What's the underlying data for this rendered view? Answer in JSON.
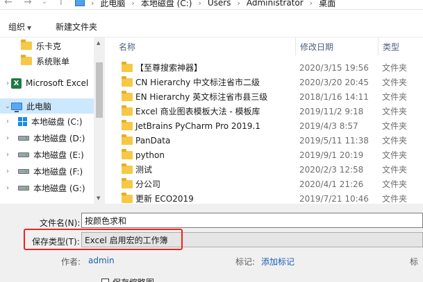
{
  "address": {
    "crumbs": [
      "此电脑",
      "本地磁盘 (C:)",
      "Users",
      "Administrator",
      "桌面"
    ]
  },
  "toolbar": {
    "organize": "组织",
    "new_folder": "新建文件夹"
  },
  "nav": {
    "items": [
      {
        "label": "乐卡克",
        "icon": "folder-icon"
      },
      {
        "label": "系统账单",
        "icon": "folder-icon"
      },
      {
        "label": "Microsoft Excel",
        "icon": "excel-icon"
      },
      {
        "label": "此电脑",
        "icon": "computer-icon"
      },
      {
        "label": "本地磁盘 (C:)",
        "icon": "windows-drive-icon"
      },
      {
        "label": "本地磁盘 (D:)",
        "icon": "drive-icon"
      },
      {
        "label": "本地磁盘 (E:)",
        "icon": "drive-icon"
      },
      {
        "label": "本地磁盘 (F:)",
        "icon": "drive-icon"
      },
      {
        "label": "本地磁盘 (G:)",
        "icon": "drive-icon"
      }
    ],
    "excel_letter": "X"
  },
  "columns": {
    "name": "名称",
    "date": "修改日期",
    "type": "类型"
  },
  "files": [
    {
      "name": "【至尊搜索神器】",
      "date": "2020/3/15 19:56",
      "type": "文件夹"
    },
    {
      "name": "CN Hierarchy 中文标注省市二级",
      "date": "2020/3/20 20:45",
      "type": "文件夹"
    },
    {
      "name": "EN Hierarchy 英文标注省市县三级",
      "date": "2018/1/16 14:11",
      "type": "文件夹"
    },
    {
      "name": "Excel 商业图表模板大法 - 模板库",
      "date": "2019/11/2 9:18",
      "type": "文件夹"
    },
    {
      "name": "JetBrains PyCharm Pro 2019.1",
      "date": "2019/4/3 8:57",
      "type": "文件夹"
    },
    {
      "name": "PanData",
      "date": "2019/5/11 11:38",
      "type": "文件夹"
    },
    {
      "name": "python",
      "date": "2019/9/1 20:19",
      "type": "文件夹"
    },
    {
      "name": "测试",
      "date": "2020/2/3 12:58",
      "type": "文件夹"
    },
    {
      "name": "分公司",
      "date": "2020/4/1 21:26",
      "type": "文件夹"
    },
    {
      "name": "更新 ECO2019",
      "date": "2019/7/21 10:46",
      "type": "文件夹"
    }
  ],
  "save": {
    "filename_label": "文件名(N):",
    "filename_value": "按颜色求和",
    "type_label": "保存类型(T):",
    "type_value": "Excel 启用宏的工作簿",
    "author_label": "作者:",
    "author_value": "admin",
    "tags_label": "标记:",
    "tags_value": "添加标记",
    "title_label": "标",
    "thumbnail_label": "保存缩略图"
  },
  "colors": {
    "selection": "#cce8ff",
    "highlight_box": "#e8251f",
    "link": "#1a5fb4"
  }
}
